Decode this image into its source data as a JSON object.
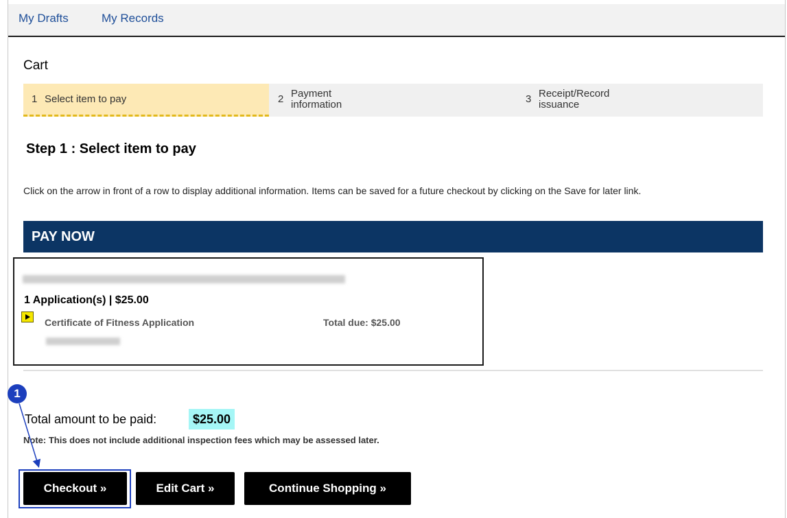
{
  "nav": {
    "my_drafts": "My Drafts",
    "my_records": "My Records"
  },
  "cart": {
    "title": "Cart"
  },
  "steps": [
    {
      "num": "1",
      "label": "Select item to pay",
      "active": true
    },
    {
      "num": "2",
      "label_line1": "Payment",
      "label_line2": "information",
      "active": false
    },
    {
      "num": "3",
      "label_line1": "Receipt/Record",
      "label_line2": "issuance",
      "active": false
    }
  ],
  "step_heading": "Step 1 : Select item to pay",
  "instructions": "Click on the arrow in front of a row to display additional information. Items can be saved for a future checkout by clicking on the Save for later link.",
  "pay_now": {
    "title": "PAY NOW"
  },
  "item": {
    "summary": "1 Application(s) | $25.00",
    "name": "Certificate of Fitness Application",
    "total_due": "Total due: $25.00"
  },
  "totals": {
    "label": "Total amount to be paid:",
    "value": "$25.00",
    "note": "Note: This does not include additional inspection fees which may be assessed later."
  },
  "buttons": {
    "checkout": "Checkout »",
    "edit_cart": "Edit Cart »",
    "continue_shopping": "Continue Shopping »"
  },
  "annotation": {
    "callout_number": "1",
    "color": "#1c3fbd"
  },
  "colors": {
    "pay_now_bg": "#0c3564",
    "active_step_bg": "#fde9b5",
    "total_highlight": "#a5f6f6",
    "link": "#1f4f99"
  }
}
